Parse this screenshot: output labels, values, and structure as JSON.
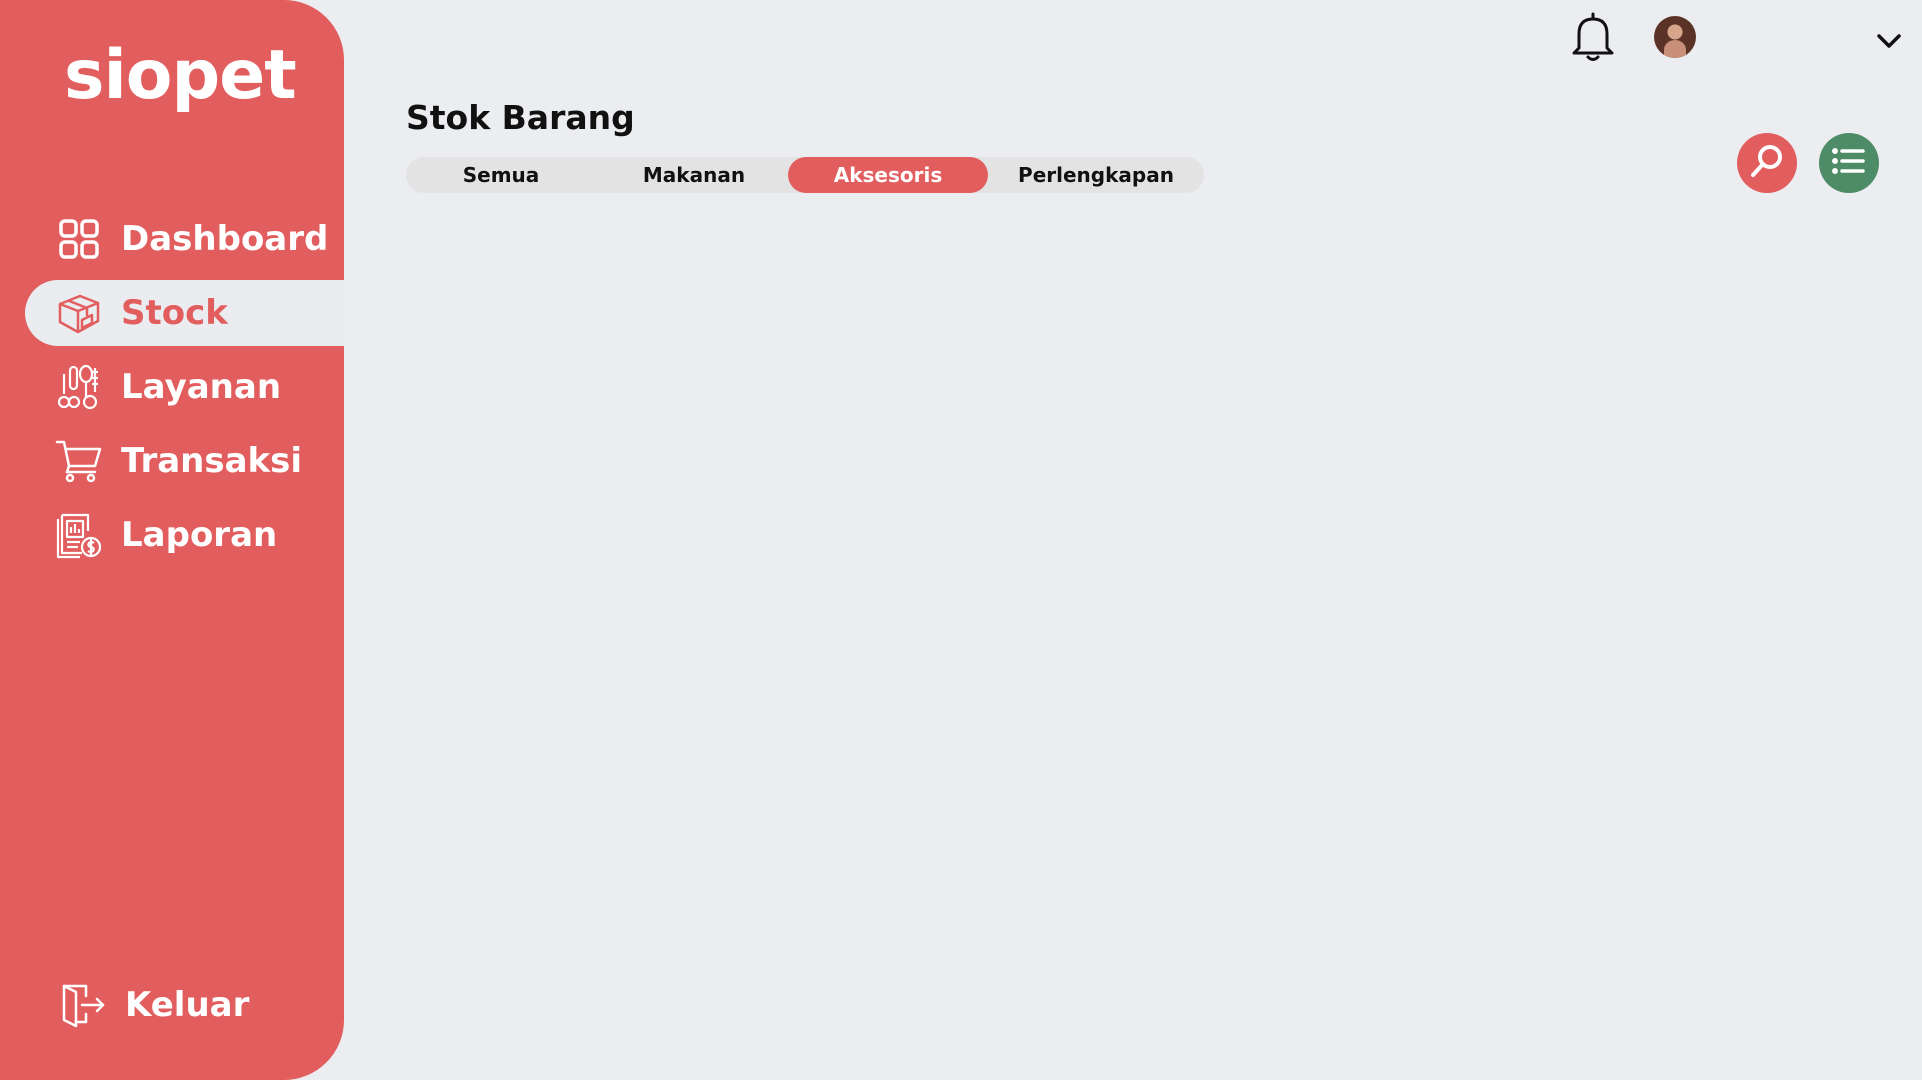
{
  "brand": {
    "name": "siopet"
  },
  "sidebar": {
    "items": [
      {
        "label": "Dashboard",
        "icon": "grid-icon"
      },
      {
        "label": "Stock",
        "icon": "box-icon",
        "active": true
      },
      {
        "label": "Layanan",
        "icon": "grooming-icon"
      },
      {
        "label": "Transaksi",
        "icon": "cart-icon"
      },
      {
        "label": "Laporan",
        "icon": "report-icon"
      }
    ],
    "logout": {
      "label": "Keluar",
      "icon": "logout-door-icon"
    }
  },
  "topbar": {
    "notification_icon": "bell-icon",
    "avatar_icon": "avatar",
    "menu_icon": "chevron-down-icon"
  },
  "main": {
    "title": "Stok Barang",
    "tabs": [
      {
        "label": "Semua"
      },
      {
        "label": "Makanan"
      },
      {
        "label": "Aksesoris",
        "active": true
      },
      {
        "label": "Perlengkapan"
      }
    ],
    "actions": {
      "search_icon": "search-icon",
      "list_icon": "list-icon"
    }
  },
  "colors": {
    "accent": "#e25d5e",
    "background": "#ecedf0",
    "list_button": "#4e8b67",
    "tab_track": "#e3e3e3"
  }
}
